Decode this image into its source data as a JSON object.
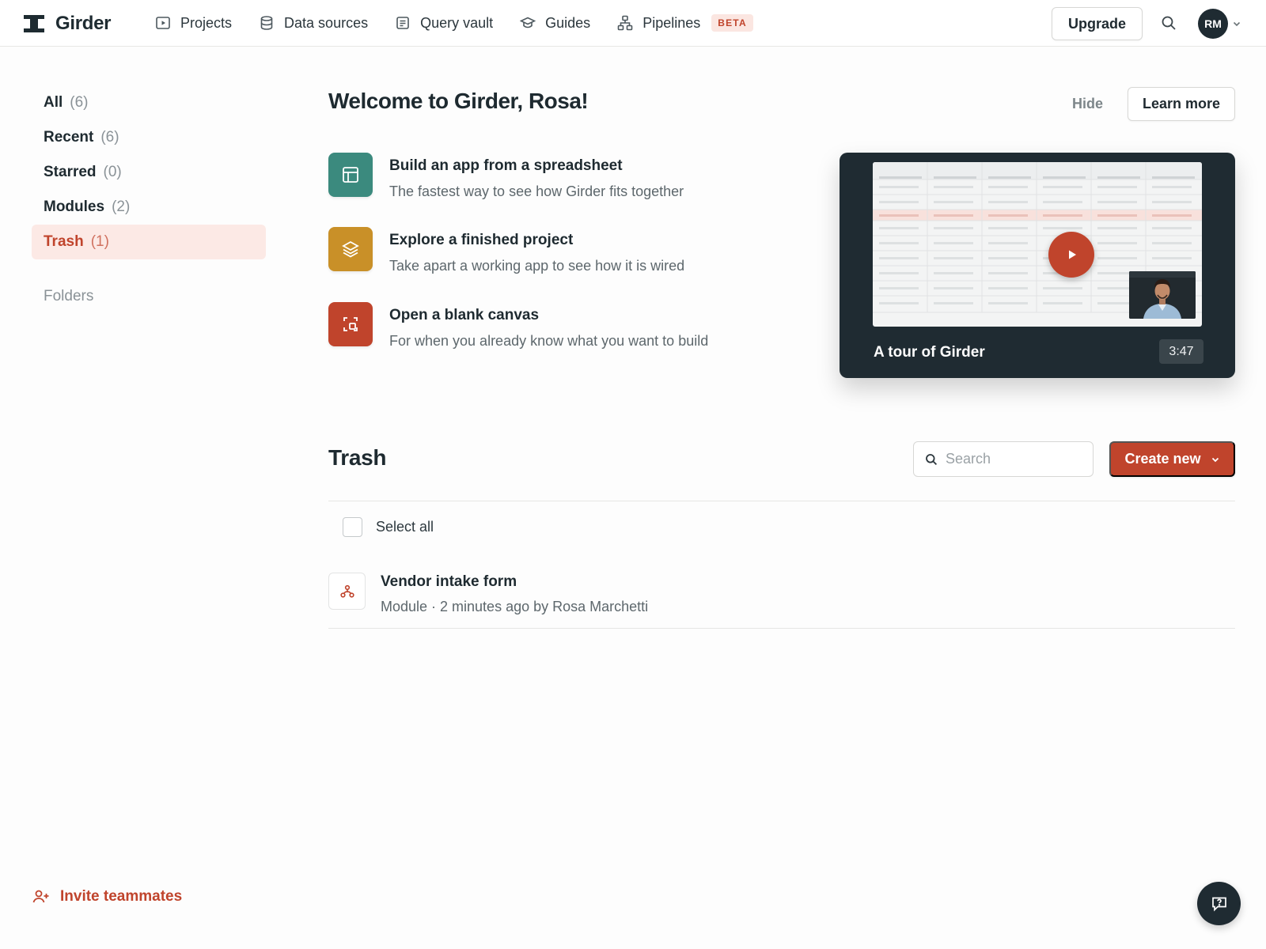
{
  "app": {
    "name": "Girder",
    "colors": {
      "accent": "#c0442c",
      "dark": "#1f2b32",
      "teal": "#3b8a7e",
      "gold": "#c99028",
      "active_bg": "#fce9e5"
    }
  },
  "nav": {
    "items": [
      {
        "label": "Projects",
        "icon": "play-square-icon"
      },
      {
        "label": "Data sources",
        "icon": "database-icon"
      },
      {
        "label": "Query vault",
        "icon": "document-list-icon"
      },
      {
        "label": "Guides",
        "icon": "graduation-cap-icon"
      },
      {
        "label": "Pipelines",
        "icon": "pipeline-icon",
        "badge": "BETA"
      }
    ],
    "upgrade_label": "Upgrade",
    "avatar_initials": "RM"
  },
  "sidebar": {
    "items": [
      {
        "label": "All",
        "count": "(6)",
        "active": false
      },
      {
        "label": "Recent",
        "count": "(6)",
        "active": false
      },
      {
        "label": "Starred",
        "count": "(0)",
        "active": false
      },
      {
        "label": "Modules",
        "count": "(2)",
        "active": false
      },
      {
        "label": "Trash",
        "count": "(1)",
        "active": true
      }
    ],
    "folders_label": "Folders",
    "invite_label": "Invite teammates"
  },
  "welcome": {
    "title": "Welcome to Girder, Rosa!",
    "hide_label": "Hide",
    "learn_more_label": "Learn more",
    "starters": [
      {
        "title": "Build an app from a spreadsheet",
        "desc": "The fastest way to see how Girder fits together",
        "icon": "table-icon",
        "color": "#3b8a7e"
      },
      {
        "title": "Explore a finished project",
        "desc": "Take apart a working app to see how it is wired",
        "icon": "layers-icon",
        "color": "#c99028"
      },
      {
        "title": "Open a blank canvas",
        "desc": "For when you already know what you want to build",
        "icon": "canvas-icon",
        "color": "#c0442c"
      }
    ],
    "video": {
      "title": "A tour of Girder",
      "duration": "3:47"
    }
  },
  "trash": {
    "title": "Trash",
    "search_placeholder": "Search",
    "create_label": "Create new",
    "select_all_label": "Select all",
    "items": [
      {
        "title": "Vendor intake form",
        "meta": "Module · 2 minutes ago by Rosa Marchetti",
        "icon": "module-icon"
      }
    ]
  }
}
